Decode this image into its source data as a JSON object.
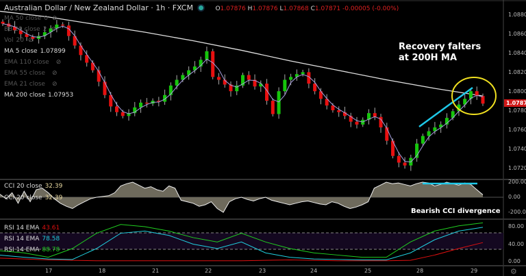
{
  "header": {
    "title": "Australian Dollar / New Zealand Dollar · 1h · FXCM",
    "o_label": "O",
    "o": "1.07876",
    "h_label": "H",
    "h": "1.07876",
    "l_label": "L",
    "l": "1.07868",
    "c_label": "C",
    "c": "1.07871",
    "change": "-0.00005 (-0.00%)"
  },
  "legend": [
    {
      "label": "MA 50 close",
      "value": "0",
      "hidden": true
    },
    {
      "label": "BB 20 close",
      "value": "2",
      "hidden": true
    },
    {
      "label": "Vol",
      "value": "20",
      "hidden": true
    },
    {
      "label": "MA 5 close",
      "value": "1.07899",
      "hidden": false
    },
    {
      "label": "EMA 110 close",
      "value": "",
      "hidden": true
    },
    {
      "label": "EMA 55 close",
      "value": "",
      "hidden": true
    },
    {
      "label": "EMA 21 close",
      "value": "",
      "hidden": true
    },
    {
      "label": "MA 200 close",
      "value": "1.07953",
      "hidden": false
    }
  ],
  "price_axis": [
    "1.08800",
    "1.08600",
    "1.08400",
    "1.08200",
    "1.08000",
    "1.07800",
    "1.07600",
    "1.07400",
    "1.07200"
  ],
  "last_price": "1.07871",
  "cci_axis": [
    "200.00",
    "0.00",
    "-200.00"
  ],
  "rsi_axis": [
    "80.00",
    "40.00",
    "0.00"
  ],
  "x_axis": [
    "17",
    "18",
    "21",
    "22",
    "23",
    "24",
    "25",
    "28",
    "29"
  ],
  "cci_legend": [
    {
      "label": "CCI 20 close",
      "value": "32.39"
    },
    {
      "label": "CCI 20 close",
      "value": "32.39"
    }
  ],
  "rsi_legend": [
    {
      "label": "RSI 14 EMA",
      "value": "43.61",
      "color": "#e01010"
    },
    {
      "label": "RSI 14 EMA",
      "value": "78.58",
      "color": "#20d0e0"
    },
    {
      "label": "RSI 14 EMA",
      "value": "88.78",
      "color": "#20d020"
    }
  ],
  "annotations": {
    "recovery_line1": "Recovery falters",
    "recovery_line2": "at 200H MA",
    "cci_note": "Bearish CCI divergence"
  },
  "colors": {
    "up": "#16c60c",
    "down": "#e81010",
    "ma200": "#e0e0e0",
    "ma5": "#a8a0e0",
    "trend": "#1ec8e8",
    "circle": "#f0e020"
  },
  "chart_data": {
    "type": "candlestick",
    "closes": [
      1.0871,
      1.0868,
      1.0864,
      1.086,
      1.0857,
      1.0855,
      1.0858,
      1.0862,
      1.0866,
      1.087,
      1.0869,
      1.0858,
      1.0848,
      1.0838,
      1.083,
      1.0822,
      1.081,
      1.0796,
      1.0784,
      1.0778,
      1.0774,
      1.0777,
      1.0783,
      1.0788,
      1.0787,
      1.079,
      1.0789,
      1.0796,
      1.0806,
      1.0812,
      1.0817,
      1.0822,
      1.0826,
      1.0833,
      1.0842,
      1.0815,
      1.0812,
      1.0807,
      1.08,
      1.0806,
      1.0817,
      1.0812,
      1.0805,
      1.0808,
      1.079,
      1.0776,
      1.08,
      1.0812,
      1.0815,
      1.0818,
      1.082,
      1.0808,
      1.08,
      1.0792,
      1.0785,
      1.078,
      1.0778,
      1.0774,
      1.0768,
      1.0765,
      1.077,
      1.0777,
      1.0773,
      1.0762,
      1.0748,
      1.0732,
      1.0725,
      1.0722,
      1.073,
      1.0745,
      1.0753,
      1.0758,
      1.0762,
      1.0765,
      1.0772,
      1.0779,
      1.0786,
      1.0792,
      1.08,
      1.0795,
      1.0787
    ],
    "ma200": [
      1.0884,
      1.0878,
      1.087,
      1.0862,
      1.0853,
      1.0843,
      1.0832,
      1.0822,
      1.0812,
      1.0803,
      1.0795
    ],
    "cci": [
      40,
      -20,
      60,
      -80,
      80,
      -60,
      100,
      120,
      60,
      -20,
      -80,
      -120,
      -150,
      -100,
      -60,
      -20,
      0,
      10,
      20,
      60,
      150,
      180,
      200,
      160,
      120,
      140,
      100,
      80,
      150,
      120,
      -40,
      -60,
      -80,
      -120,
      -100,
      -60,
      -150,
      -200,
      -60,
      -20,
      0,
      -30,
      -50,
      -20,
      0,
      -40,
      -60,
      -80,
      -100,
      -80,
      -60,
      -50,
      -70,
      -90,
      -100,
      -60,
      -80,
      -120,
      -150,
      -130,
      -100,
      -60,
      120,
      160,
      200,
      180,
      190,
      170,
      150,
      180,
      200,
      190,
      150,
      170,
      200,
      180,
      160,
      190,
      170,
      100,
      32.39
    ],
    "rsi_red": [
      8,
      6,
      4,
      3,
      2,
      2,
      2,
      2,
      2,
      2,
      2,
      3,
      4,
      3,
      2,
      2,
      2,
      3,
      15,
      30,
      43.61
    ],
    "rsi_cyan": [
      15,
      10,
      6,
      5,
      30,
      65,
      70,
      60,
      40,
      30,
      45,
      20,
      10,
      6,
      5,
      4,
      4,
      20,
      50,
      70,
      78.58
    ],
    "rsi_green": [
      25,
      20,
      10,
      30,
      65,
      85,
      80,
      70,
      55,
      45,
      65,
      45,
      30,
      20,
      15,
      10,
      10,
      45,
      70,
      82,
      88.78
    ],
    "price_range": [
      1.0714,
      1.0886
    ],
    "cci_range": [
      -260,
      260
    ],
    "rsi_range": [
      0,
      100
    ]
  }
}
